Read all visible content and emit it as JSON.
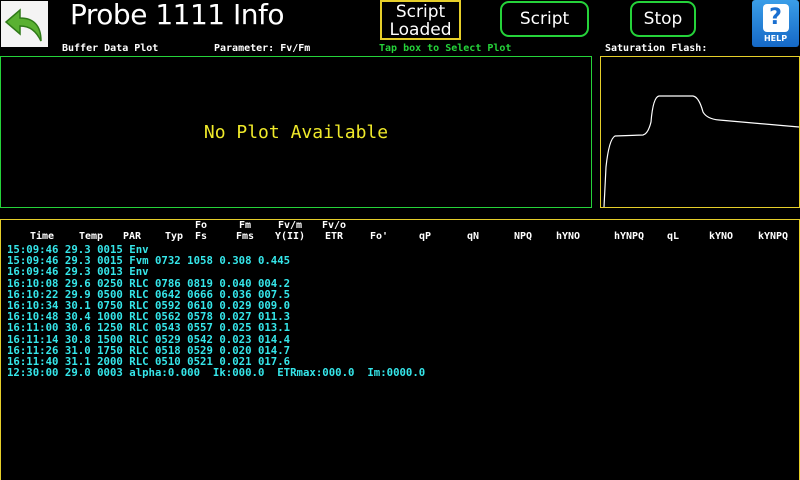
{
  "header": {
    "title": "Probe 1111 Info",
    "status": [
      "Script",
      "Loaded"
    ],
    "script_button": "Script",
    "stop_button": "Stop",
    "help_label": "HELP",
    "help_glyph": "?"
  },
  "labels": {
    "buffer_plot": "Buffer Data Plot",
    "parameter": "Parameter: Fv/Fm",
    "tap_hint": "Tap box to Select Plot",
    "saturation": "Saturation Flash:"
  },
  "plot": {
    "message": "No Plot Available"
  },
  "table": {
    "columns": [
      {
        "top": "",
        "bottom": "Time"
      },
      {
        "top": "",
        "bottom": "Temp"
      },
      {
        "top": "",
        "bottom": "PAR"
      },
      {
        "top": "",
        "bottom": "Typ"
      },
      {
        "top": "Fo",
        "bottom": "Fs"
      },
      {
        "top": "Fm",
        "bottom": "Fms"
      },
      {
        "top": "Fv/m",
        "bottom": "Y(II)"
      },
      {
        "top": "Fv/o",
        "bottom": "ETR"
      },
      {
        "top": "",
        "bottom": "Fo'"
      },
      {
        "top": "",
        "bottom": "qP"
      },
      {
        "top": "",
        "bottom": "qN"
      },
      {
        "top": "",
        "bottom": "NPQ"
      },
      {
        "top": "",
        "bottom": "hYNO"
      },
      {
        "top": "",
        "bottom": "hYNPQ"
      },
      {
        "top": "",
        "bottom": "qL"
      },
      {
        "top": "",
        "bottom": "kYNO"
      },
      {
        "top": "",
        "bottom": "kYNPQ"
      }
    ],
    "rows": [
      "15:09:46 29.3 0015 Env",
      "15:09:46 29.3 0015 Fvm 0732 1058 0.308 0.445",
      "16:09:46 29.3 0013 Env",
      "16:10:08 29.6 0250 RLC 0786 0819 0.040 004.2",
      "16:10:22 29.9 0500 RLC 0642 0666 0.036 007.5",
      "16:10:34 30.1 0750 RLC 0592 0610 0.029 009.0",
      "16:10:48 30.4 1000 RLC 0562 0578 0.027 011.3",
      "16:11:00 30.6 1250 RLC 0543 0557 0.025 013.1",
      "16:11:14 30.8 1500 RLC 0529 0542 0.023 014.4",
      "16:11:26 31.0 1750 RLC 0518 0529 0.020 014.7",
      "16:11:40 31.1 2000 RLC 0510 0521 0.021 017.6",
      "12:30:00 29.0 0003 alpha:0.000  Ik:000.0  ETRmax:000.0  Im:0000.0"
    ]
  },
  "colors": {
    "green": "#25d33a",
    "yellow": "#e6cf2a",
    "cyan": "#35e6ea"
  },
  "icons": {
    "back": "back-arrow-icon",
    "help": "help-question-icon"
  }
}
